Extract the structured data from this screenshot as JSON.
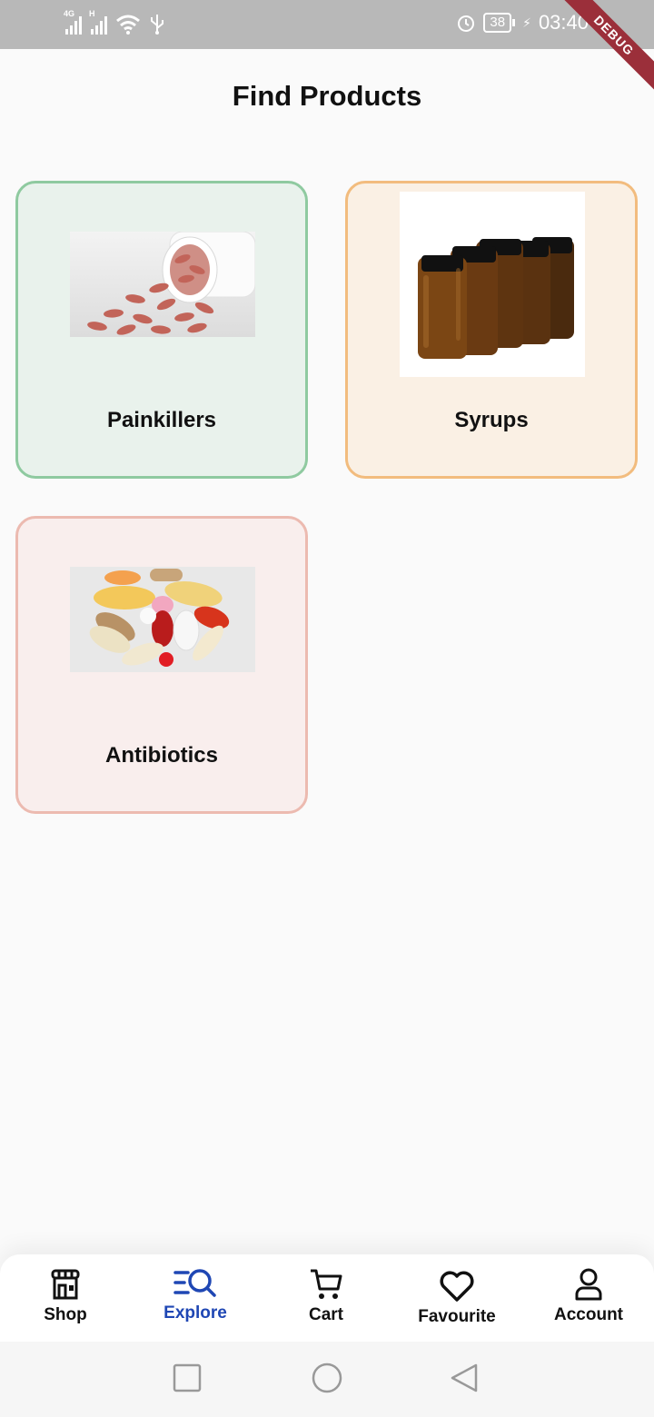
{
  "status_bar": {
    "net1": "4G",
    "net2": "H",
    "battery": "38",
    "time": "03:40",
    "debug_label": "DEBUG"
  },
  "header": {
    "title": "Find Products"
  },
  "categories": [
    {
      "label": "Painkillers",
      "bg": "#e9f2ec",
      "border": "#8fcaa0"
    },
    {
      "label": "Syrups",
      "bg": "#faf0e4",
      "border": "#f2bc7e"
    },
    {
      "label": "Antibiotics",
      "bg": "#f9eeed",
      "border": "#ecbab0"
    }
  ],
  "nav": {
    "active_color": "#1f47b4",
    "items": [
      {
        "label": "Shop",
        "icon": "store-icon"
      },
      {
        "label": "Explore",
        "icon": "explore-search-icon",
        "active": true
      },
      {
        "label": "Cart",
        "icon": "cart-icon"
      },
      {
        "label": "Favourite",
        "icon": "heart-icon"
      },
      {
        "label": "Account",
        "icon": "user-icon"
      }
    ]
  },
  "system_nav": [
    "recent-apps-button",
    "home-button",
    "back-button"
  ]
}
